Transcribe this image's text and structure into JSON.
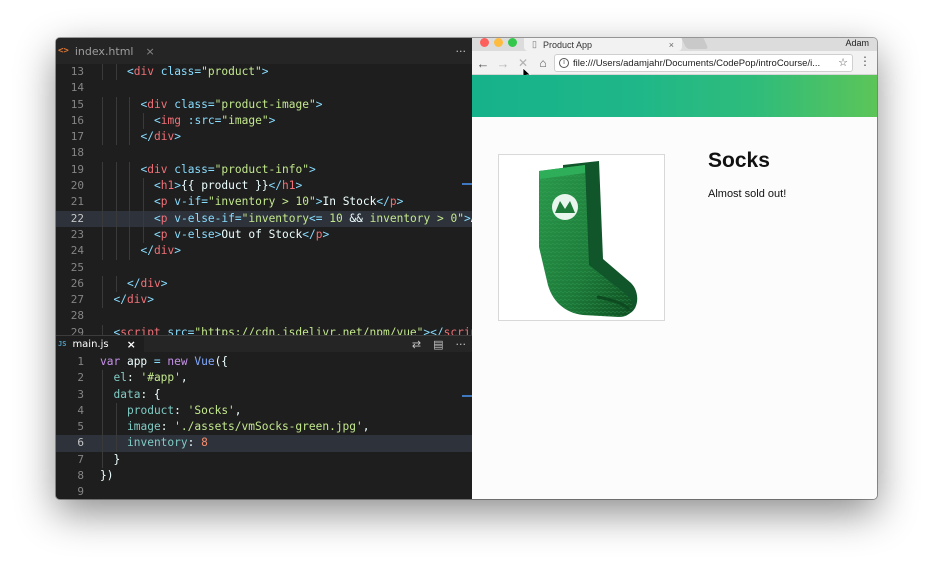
{
  "editor": {
    "html_tab": {
      "icon": "<>",
      "title": "index.html",
      "close": "×"
    },
    "js_tab": {
      "icon": "JS",
      "title": "main.js",
      "close": "×"
    },
    "actions": {
      "more": "···",
      "compare": "⇄",
      "split": "▤"
    },
    "html_lines": [
      {
        "n": "13",
        "indent": 2,
        "tokens": [
          [
            "tk-punc",
            "<"
          ],
          [
            "tk-tag",
            "div"
          ],
          [
            "tk-txt",
            " "
          ],
          [
            "tk-attr",
            "class"
          ],
          [
            "tk-punc",
            "="
          ],
          [
            "tk-str",
            "\"product\""
          ],
          [
            "tk-punc",
            ">"
          ]
        ]
      },
      {
        "n": "14",
        "indent": 0,
        "tokens": []
      },
      {
        "n": "15",
        "indent": 3,
        "tokens": [
          [
            "tk-punc",
            "<"
          ],
          [
            "tk-tag",
            "div"
          ],
          [
            "tk-txt",
            " "
          ],
          [
            "tk-attr",
            "class"
          ],
          [
            "tk-punc",
            "="
          ],
          [
            "tk-str",
            "\"product-image\""
          ],
          [
            "tk-punc",
            ">"
          ]
        ]
      },
      {
        "n": "16",
        "indent": 4,
        "tokens": [
          [
            "tk-punc",
            "<"
          ],
          [
            "tk-tag",
            "img"
          ],
          [
            "tk-txt",
            " "
          ],
          [
            "tk-attr",
            ":src"
          ],
          [
            "tk-punc",
            "="
          ],
          [
            "tk-str",
            "\"image\""
          ],
          [
            "tk-punc",
            ">"
          ]
        ]
      },
      {
        "n": "17",
        "indent": 3,
        "tokens": [
          [
            "tk-punc",
            "</"
          ],
          [
            "tk-tag",
            "div"
          ],
          [
            "tk-punc",
            ">"
          ]
        ]
      },
      {
        "n": "18",
        "indent": 0,
        "tokens": []
      },
      {
        "n": "19",
        "indent": 3,
        "tokens": [
          [
            "tk-punc",
            "<"
          ],
          [
            "tk-tag",
            "div"
          ],
          [
            "tk-txt",
            " "
          ],
          [
            "tk-attr",
            "class"
          ],
          [
            "tk-punc",
            "="
          ],
          [
            "tk-str",
            "\"product-info\""
          ],
          [
            "tk-punc",
            ">"
          ]
        ]
      },
      {
        "n": "20",
        "indent": 4,
        "tokens": [
          [
            "tk-punc",
            "<"
          ],
          [
            "tk-tag",
            "h1"
          ],
          [
            "tk-punc",
            ">"
          ],
          [
            "tk-txt",
            "{{ product }}"
          ],
          [
            "tk-punc",
            "</"
          ],
          [
            "tk-tag",
            "h1"
          ],
          [
            "tk-punc",
            ">"
          ]
        ]
      },
      {
        "n": "21",
        "indent": 4,
        "tokens": [
          [
            "tk-punc",
            "<"
          ],
          [
            "tk-tag",
            "p"
          ],
          [
            "tk-txt",
            " "
          ],
          [
            "tk-attr",
            "v-if"
          ],
          [
            "tk-punc",
            "="
          ],
          [
            "tk-str",
            "\"inventory > 10\""
          ],
          [
            "tk-punc",
            ">"
          ],
          [
            "tk-txt",
            "In Stock"
          ],
          [
            "tk-punc",
            "</"
          ],
          [
            "tk-tag",
            "p"
          ],
          [
            "tk-punc",
            ">"
          ]
        ]
      },
      {
        "n": "22",
        "indent": 4,
        "active": true,
        "tokens": [
          [
            "tk-punc",
            "<"
          ],
          [
            "tk-tag",
            "p"
          ],
          [
            "tk-txt",
            " "
          ],
          [
            "tk-attr",
            "v-else-if"
          ],
          [
            "tk-punc",
            "="
          ],
          [
            "tk-str",
            "\"inventory"
          ],
          [
            "tk-op",
            "<="
          ],
          [
            "tk-str",
            " 10 "
          ],
          [
            "tk-txt",
            "&&"
          ],
          [
            "tk-str",
            " inventory > 0\""
          ],
          [
            "tk-punc",
            ">"
          ],
          [
            "tk-txt",
            "Al"
          ]
        ]
      },
      {
        "n": "23",
        "indent": 4,
        "tokens": [
          [
            "tk-punc",
            "<"
          ],
          [
            "tk-tag",
            "p"
          ],
          [
            "tk-txt",
            " "
          ],
          [
            "tk-attr",
            "v-else"
          ],
          [
            "tk-punc",
            ">"
          ],
          [
            "tk-txt",
            "Out of Stock"
          ],
          [
            "tk-punc",
            "</"
          ],
          [
            "tk-tag",
            "p"
          ],
          [
            "tk-punc",
            ">"
          ]
        ]
      },
      {
        "n": "24",
        "indent": 3,
        "tokens": [
          [
            "tk-punc",
            "</"
          ],
          [
            "tk-tag",
            "div"
          ],
          [
            "tk-punc",
            ">"
          ]
        ]
      },
      {
        "n": "25",
        "indent": 0,
        "tokens": []
      },
      {
        "n": "26",
        "indent": 2,
        "tokens": [
          [
            "tk-punc",
            "</"
          ],
          [
            "tk-tag",
            "div"
          ],
          [
            "tk-punc",
            ">"
          ]
        ]
      },
      {
        "n": "27",
        "indent": 1,
        "tokens": [
          [
            "tk-punc",
            "</"
          ],
          [
            "tk-tag",
            "div"
          ],
          [
            "tk-punc",
            ">"
          ]
        ]
      },
      {
        "n": "28",
        "indent": 0,
        "tokens": []
      },
      {
        "n": "29",
        "indent": 1,
        "tokens": [
          [
            "tk-punc",
            "<"
          ],
          [
            "tk-tag",
            "script"
          ],
          [
            "tk-txt",
            " "
          ],
          [
            "tk-attr",
            "src"
          ],
          [
            "tk-punc",
            "="
          ],
          [
            "tk-str",
            "\"https://cdn.jsdelivr.net/npm/vue\""
          ],
          [
            "tk-punc",
            "></"
          ],
          [
            "tk-tag",
            "script"
          ]
        ]
      }
    ],
    "js_lines": [
      {
        "n": "1",
        "indent": 0,
        "tokens": [
          [
            "tk-keyword",
            "var"
          ],
          [
            "tk-var",
            " app "
          ],
          [
            "tk-op",
            "="
          ],
          [
            "tk-keyword",
            " new "
          ],
          [
            "tk-fn",
            "Vue"
          ],
          [
            "tk-txt",
            "({"
          ]
        ]
      },
      {
        "n": "2",
        "indent": 1,
        "tokens": [
          [
            "tk-prop",
            "el"
          ],
          [
            "tk-txt",
            ": "
          ],
          [
            "tk-str",
            "'#app'"
          ],
          [
            "tk-txt",
            ","
          ]
        ]
      },
      {
        "n": "3",
        "indent": 1,
        "tokens": [
          [
            "tk-prop",
            "data"
          ],
          [
            "tk-txt",
            ": {"
          ]
        ]
      },
      {
        "n": "4",
        "indent": 2,
        "tokens": [
          [
            "tk-prop",
            "product"
          ],
          [
            "tk-txt",
            ": "
          ],
          [
            "tk-str",
            "'Socks'"
          ],
          [
            "tk-txt",
            ","
          ]
        ]
      },
      {
        "n": "5",
        "indent": 2,
        "tokens": [
          [
            "tk-prop",
            "image"
          ],
          [
            "tk-txt",
            ": "
          ],
          [
            "tk-str",
            "'./assets/vmSocks-green.jpg'"
          ],
          [
            "tk-txt",
            ","
          ]
        ]
      },
      {
        "n": "6",
        "indent": 2,
        "active": true,
        "tokens": [
          [
            "tk-prop",
            "inventory"
          ],
          [
            "tk-txt",
            ": "
          ],
          [
            "tk-num",
            "8"
          ]
        ]
      },
      {
        "n": "7",
        "indent": 1,
        "tokens": [
          [
            "tk-txt",
            "}"
          ]
        ]
      },
      {
        "n": "8",
        "indent": 0,
        "tokens": [
          [
            "tk-txt",
            "})"
          ]
        ]
      },
      {
        "n": "9",
        "indent": 0,
        "tokens": []
      }
    ]
  },
  "browser": {
    "tab_title": "Product App",
    "tab_close": "×",
    "profile_name": "Adam",
    "url": "file:///Users/adamjahr/Documents/CodePop/introCourse/i...",
    "nav": {
      "back": "←",
      "forward": "→",
      "stop": "✕",
      "home": "⌂",
      "star": "☆",
      "menu": "⋮",
      "info": "i",
      "page": "▯"
    },
    "page": {
      "product": "Socks",
      "stock_message": "Almost sold out!",
      "image_alt": "green vue mastery sock"
    },
    "banner_gradient": [
      "#16b28a",
      "#5cc558"
    ]
  },
  "colors": {
    "editor_bg": "#1e1e1e",
    "line_highlight": "#2d323b",
    "sock_green": "#1e7a3a"
  }
}
